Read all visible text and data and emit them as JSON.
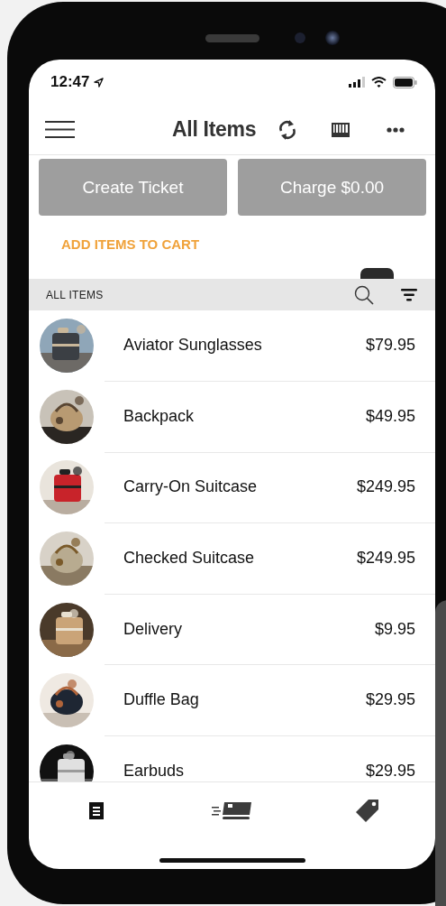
{
  "status_bar": {
    "time": "12:47"
  },
  "header": {
    "title": "All Items"
  },
  "actions": [
    {
      "label": "Create Ticket",
      "disabled": true
    },
    {
      "label": "Charge $0.00",
      "disabled": true
    }
  ],
  "add_items_link": "ADD ITEMS TO CART",
  "section": {
    "title": "ALL ITEMS"
  },
  "items": [
    {
      "name": "Aviator Sunglasses",
      "price": "$79.95"
    },
    {
      "name": "Backpack",
      "price": "$49.95"
    },
    {
      "name": "Carry-On Suitcase",
      "price": "$249.95"
    },
    {
      "name": "Checked Suitcase",
      "price": "$249.95"
    },
    {
      "name": "Delivery",
      "price": "$9.95"
    },
    {
      "name": "Duffle Bag",
      "price": "$29.95"
    },
    {
      "name": "Earbuds",
      "price": "$29.95"
    }
  ],
  "tab_bar": [
    {
      "selected": true
    },
    {
      "selected": false
    },
    {
      "selected": false
    }
  ]
}
